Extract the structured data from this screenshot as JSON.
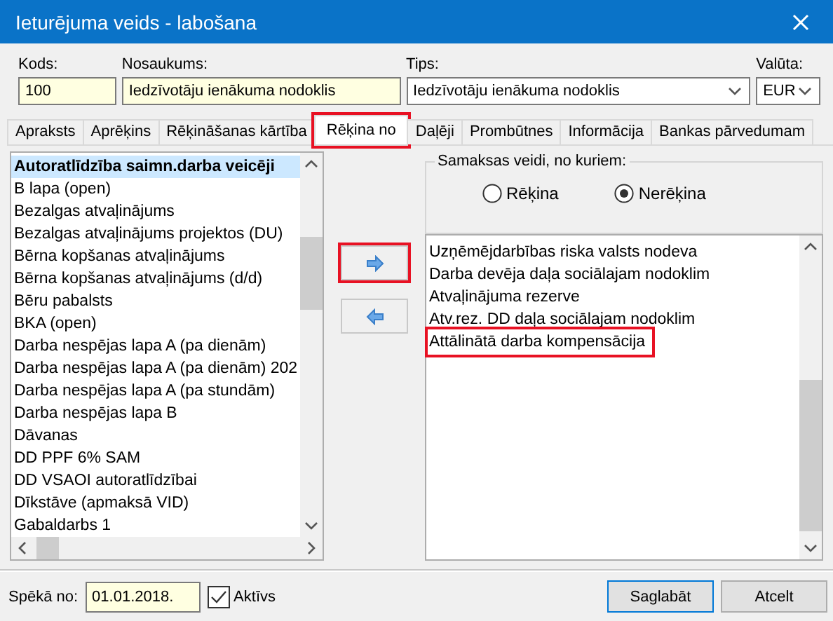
{
  "window": {
    "title": "Ieturējuma veids - labošana"
  },
  "fields": [
    {
      "kind": "text",
      "label": "Kods:",
      "value": "100"
    },
    {
      "kind": "text",
      "label": "Nosaukums:",
      "value": "Iedzīvotāju ienākuma nodoklis"
    },
    {
      "kind": "dropdown",
      "label": "Tips:",
      "value": "Iedzīvotāju ienākuma nodoklis"
    },
    {
      "kind": "dropdown",
      "label": "Valūta:",
      "value": "EUR"
    }
  ],
  "tabs": [
    {
      "label": "Apraksts",
      "selected": false,
      "highlighted": false
    },
    {
      "label": "Aprēķins",
      "selected": false,
      "highlighted": false
    },
    {
      "label": "Rēķināšanas kārtība",
      "selected": false,
      "highlighted": false
    },
    {
      "label": "Rēķina no",
      "selected": true,
      "highlighted": true
    },
    {
      "label": "Daļēji",
      "selected": false,
      "highlighted": false
    },
    {
      "label": "Prombūtnes",
      "selected": false,
      "highlighted": false
    },
    {
      "label": "Informācija",
      "selected": false,
      "highlighted": false
    },
    {
      "label": "Bankas pārvedumam",
      "selected": false,
      "highlighted": false
    }
  ],
  "available_list": {
    "items": [
      {
        "label": "Autoratlīdzība saimn.darba veicēji",
        "selected": true
      },
      {
        "label": "B lapa (open)",
        "selected": false
      },
      {
        "label": "Bezalgas atvaļinājums",
        "selected": false
      },
      {
        "label": "Bezalgas atvaļinājums projektos (DU)",
        "selected": false
      },
      {
        "label": "Bērna kopšanas atvaļinājums",
        "selected": false
      },
      {
        "label": "Bērna kopšanas atvaļinājums (d/d)",
        "selected": false
      },
      {
        "label": "Bēru pabalsts",
        "selected": false
      },
      {
        "label": "BKA (open)",
        "selected": false
      },
      {
        "label": "Darba nespējas lapa  A (pa dienām)",
        "selected": false
      },
      {
        "label": "Darba nespējas lapa  A (pa dienām) 202",
        "selected": false
      },
      {
        "label": "Darba nespējas lapa  A (pa stundām)",
        "selected": false
      },
      {
        "label": "Darba nespējas lapa  B",
        "selected": false
      },
      {
        "label": "Dāvanas",
        "selected": false
      },
      {
        "label": "DD PPF 6% SAM",
        "selected": false
      },
      {
        "label": "DD VSAOI autoratlīdzībai",
        "selected": false
      },
      {
        "label": "Dīkstāve (apmaksā VID)",
        "selected": false
      },
      {
        "label": "Gabaldarbs 1",
        "selected": false
      }
    ]
  },
  "move_buttons": [
    {
      "kind": "add",
      "highlighted": true
    },
    {
      "kind": "remove",
      "highlighted": false
    }
  ],
  "payment_group": {
    "title": "Samaksas veidi, no kuriem:",
    "options": [
      {
        "label": "Rēķina",
        "selected": false
      },
      {
        "label": "Nerēķina",
        "selected": true
      }
    ]
  },
  "chosen_list": {
    "items": [
      {
        "label": "Uzņēmējdarbības riska valsts nodeva",
        "highlighted": false
      },
      {
        "label": "Darba devēja daļa sociālajam nodoklim",
        "highlighted": false
      },
      {
        "label": "Atvaļinājuma rezerve",
        "highlighted": false
      },
      {
        "label": "Atv.rez. DD daļa sociālajam nodoklim",
        "highlighted": false
      },
      {
        "label": "Attālinātā darba kompensācija",
        "highlighted": true
      }
    ]
  },
  "footer": {
    "date_label": "Spēkā no:",
    "date_value": "01.01.2018.",
    "active": {
      "label": "Aktīvs",
      "checked": true
    },
    "buttons": [
      {
        "label": "Saglabāt",
        "default": true
      },
      {
        "label": "Atcelt",
        "default": false
      }
    ]
  }
}
